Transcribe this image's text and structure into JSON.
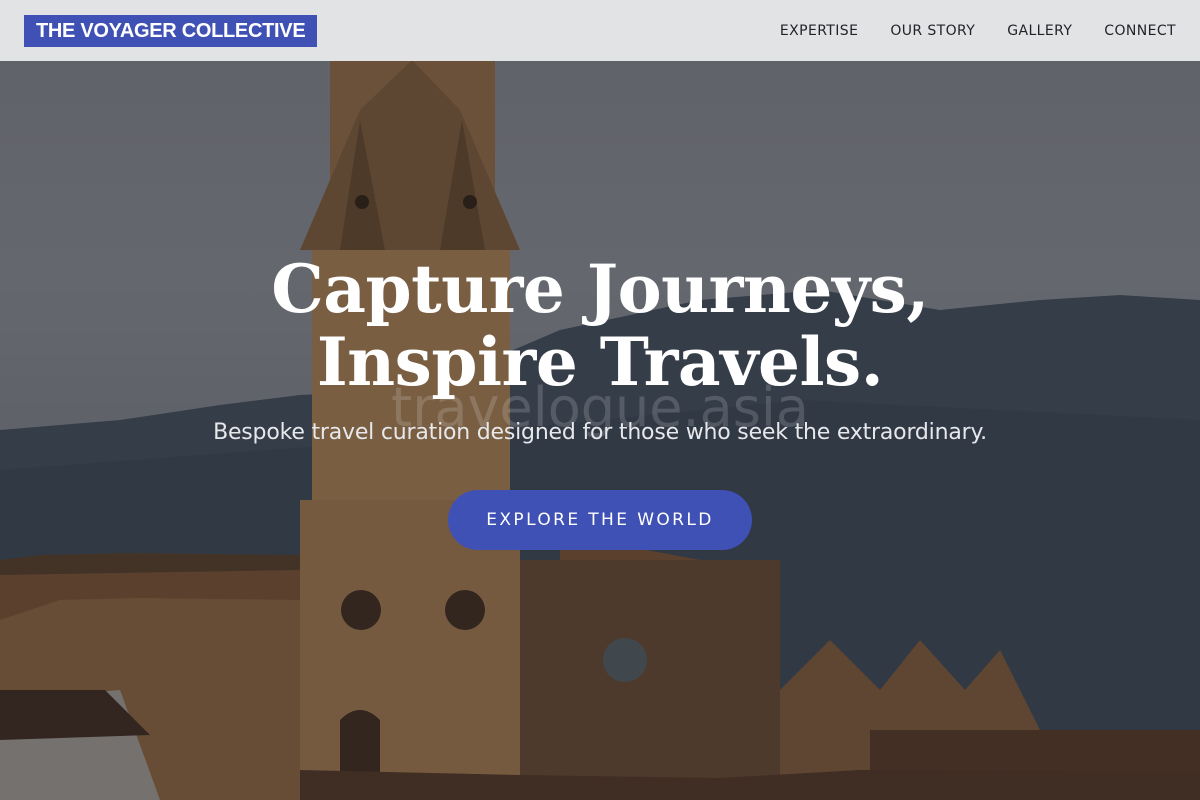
{
  "brand": {
    "name": "THE VOYAGER COLLECTIVE",
    "color": "#3f51b5"
  },
  "nav": {
    "items": [
      {
        "label": "EXPERTISE"
      },
      {
        "label": "OUR STORY"
      },
      {
        "label": "GALLERY"
      },
      {
        "label": "CONNECT"
      }
    ]
  },
  "hero": {
    "headline_line1": "Capture Journeys,",
    "headline_line2": "Inspire Travels.",
    "watermark": "travelogue.asia",
    "tagline": "Bespoke travel curation designed for those who seek the extraordinary.",
    "cta_label": "EXPLORE THE WORLD",
    "background": "bell tower and church rooftops with mountains"
  }
}
